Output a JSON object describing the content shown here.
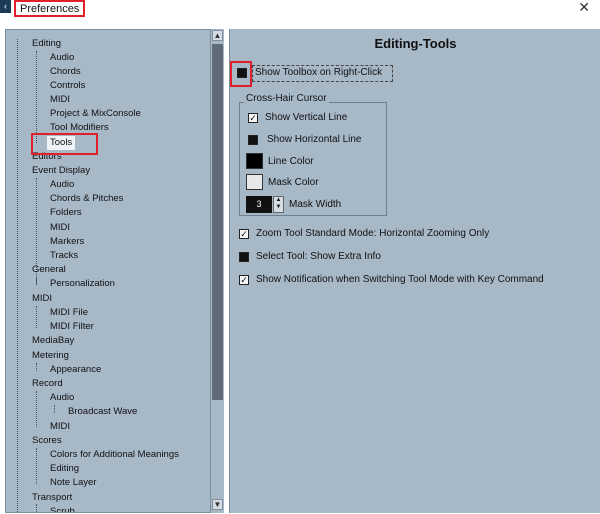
{
  "window": {
    "title": "Preferences",
    "app_icon": "app-icon",
    "close_icon": "close-icon",
    "close_glyph": "✕"
  },
  "tree": {
    "items": [
      {
        "label": "Editing",
        "level": 0
      },
      {
        "label": "Audio",
        "level": 1
      },
      {
        "label": "Chords",
        "level": 1
      },
      {
        "label": "Controls",
        "level": 1
      },
      {
        "label": "MIDI",
        "level": 1
      },
      {
        "label": "Project & MixConsole",
        "level": 1
      },
      {
        "label": "Tool Modifiers",
        "level": 1
      },
      {
        "label": "Tools",
        "level": 1,
        "selected": true
      },
      {
        "label": "Editors",
        "level": 0
      },
      {
        "label": "Event Display",
        "level": 0
      },
      {
        "label": "Audio",
        "level": 1
      },
      {
        "label": "Chords & Pitches",
        "level": 1
      },
      {
        "label": "Folders",
        "level": 1
      },
      {
        "label": "MIDI",
        "level": 1
      },
      {
        "label": "Markers",
        "level": 1
      },
      {
        "label": "Tracks",
        "level": 1
      },
      {
        "label": "General",
        "level": 0
      },
      {
        "label": "Personalization",
        "level": 1
      },
      {
        "label": "MIDI",
        "level": 0
      },
      {
        "label": "MIDI File",
        "level": 1
      },
      {
        "label": "MIDI Filter",
        "level": 1
      },
      {
        "label": "MediaBay",
        "level": 0
      },
      {
        "label": "Metering",
        "level": 0
      },
      {
        "label": "Appearance",
        "level": 1
      },
      {
        "label": "Record",
        "level": 0
      },
      {
        "label": "Audio",
        "level": 1
      },
      {
        "label": "Broadcast Wave",
        "level": 2
      },
      {
        "label": "MIDI",
        "level": 1
      },
      {
        "label": "Scores",
        "level": 0
      },
      {
        "label": "Colors for Additional Meanings",
        "level": 1
      },
      {
        "label": "Editing",
        "level": 1
      },
      {
        "label": "Note Layer",
        "level": 1
      },
      {
        "label": "Transport",
        "level": 0
      },
      {
        "label": "Scrub",
        "level": 1
      }
    ]
  },
  "scrollbar": {
    "up_glyph": "▲",
    "down_glyph": "▼"
  },
  "panel": {
    "title": "Editing-Tools",
    "show_toolbox": {
      "label": "Show Toolbox on Right-Click",
      "checked": false
    },
    "crosshair": {
      "legend": "Cross-Hair Cursor",
      "show_vertical": {
        "label": "Show Vertical Line",
        "checked": true
      },
      "show_horizontal": {
        "label": "Show Horizontal Line",
        "checked": false
      },
      "line_color": {
        "label": "Line Color",
        "color": "#000000"
      },
      "mask_color": {
        "label": "Mask Color",
        "color": "#e8e8e8"
      },
      "mask_width": {
        "label": "Mask Width",
        "value": "3"
      }
    },
    "zoom_tool": {
      "label": "Zoom Tool Standard Mode: Horizontal Zooming Only",
      "checked": true
    },
    "select_tool": {
      "label": "Select Tool: Show Extra Info",
      "checked": false
    },
    "show_notification": {
      "label": "Show Notification when Switching Tool Mode with Key Command",
      "checked": true
    }
  },
  "colors": {
    "panel_bg": "#a7b8c7",
    "highlight": "#e0202a",
    "selected_bg": "#eef2f7"
  }
}
